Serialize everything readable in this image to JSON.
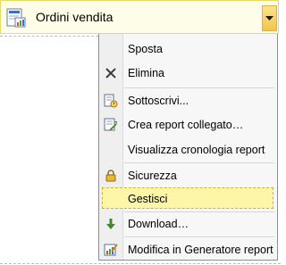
{
  "report": {
    "title": "Ordini vendita",
    "icon": "report-icon",
    "dropdown_icon": "chevron-down-icon"
  },
  "menu": {
    "items": [
      {
        "label": "Sposta",
        "icon": null
      },
      {
        "label": "Elimina",
        "icon": "close-icon"
      },
      {
        "label": "Sottoscrivi...",
        "icon": "subscribe-icon"
      },
      {
        "label": "Crea report collegato…",
        "icon": "linked-report-icon"
      },
      {
        "label": "Visualizza cronologia report",
        "icon": null
      },
      {
        "label": "Sicurezza",
        "icon": "lock-icon"
      },
      {
        "label": "Gestisci",
        "icon": null,
        "active": true
      },
      {
        "label": "Download…",
        "icon": "download-icon"
      },
      {
        "label": "Modifica in Generatore report",
        "icon": "report-builder-icon"
      }
    ]
  },
  "colors": {
    "highlight_bg": "#fdf6a8",
    "highlight_border": "#c9b433",
    "dropdown_fill": "#f3c54b"
  }
}
